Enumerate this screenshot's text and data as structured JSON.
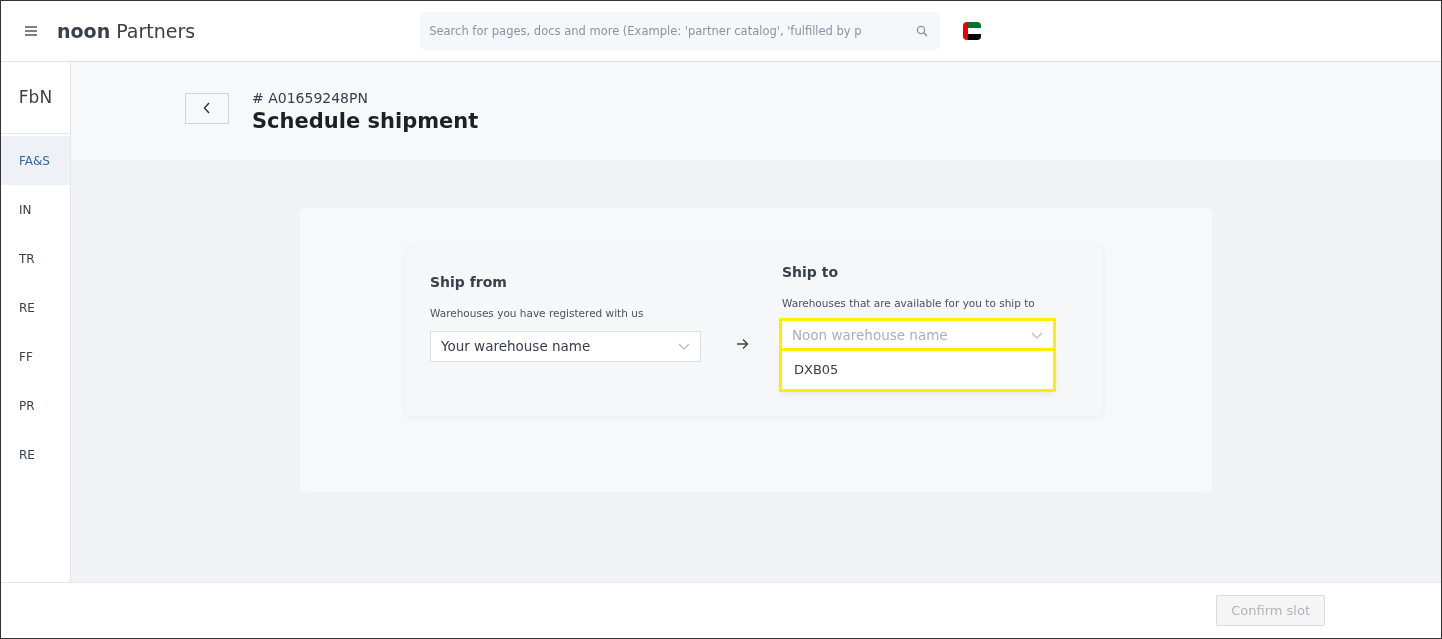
{
  "header": {
    "brand_bold": "noon",
    "brand_rest": "Partners",
    "search": {
      "placeholder": "Search for pages, docs and more (Example: 'partner catalog', 'fulfilled by p"
    }
  },
  "sidebar": {
    "title": "FbN",
    "items": [
      {
        "label": "FA&S",
        "selected": true
      },
      {
        "label": "IN",
        "selected": false
      },
      {
        "label": "TR",
        "selected": false
      },
      {
        "label": "RE",
        "selected": false
      },
      {
        "label": "FF",
        "selected": false
      },
      {
        "label": "PR",
        "selected": false
      },
      {
        "label": "RE",
        "selected": false
      }
    ]
  },
  "page": {
    "reference": "# A01659248PN",
    "title": "Schedule shipment"
  },
  "ship_from": {
    "title": "Ship from",
    "description": "Warehouses you have registered with us",
    "select": {
      "value": "Your warehouse name",
      "expanded": false
    }
  },
  "ship_to": {
    "title": "Ship to",
    "description": "Warehouses that are available for you to ship to",
    "select": {
      "placeholder": "Noon warehouse name",
      "expanded": true,
      "highlighted": true,
      "options": [
        "DXB05"
      ]
    }
  },
  "footer": {
    "button": {
      "label": "Confirm slot",
      "disabled": true
    }
  }
}
